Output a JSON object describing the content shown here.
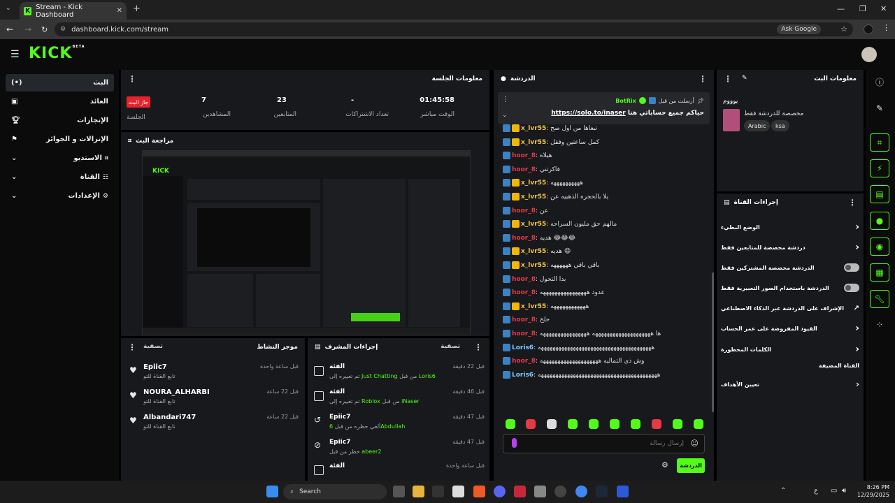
{
  "browser": {
    "tab_title": "Stream - Kick Dashboard",
    "url": "dashboard.kick.com/stream",
    "ask_google": "Ask Google"
  },
  "header": {
    "logo": "KICK",
    "logo_sup": "BETA"
  },
  "sidebar": {
    "items": [
      {
        "label": "البث",
        "icon": "broadcast-icon"
      },
      {
        "label": "العائد",
        "icon": "revenue-icon"
      },
      {
        "label": "الإنجازات",
        "icon": "trophy-icon"
      },
      {
        "label": "الإنزالات و الجوائز",
        "icon": "drops-icon"
      },
      {
        "label": "الاستديو",
        "icon": "studio-icon"
      },
      {
        "label": "القناة",
        "icon": "channel-icon"
      },
      {
        "label": "الإعدادات",
        "icon": "settings-icon"
      }
    ]
  },
  "session": {
    "title": "معلومات الجلسة",
    "live_badge": "جاز البث",
    "session_label": "الجلسة",
    "stats": [
      {
        "value": "01:45:58",
        "label": "الوقت مباشر"
      },
      {
        "value": "-",
        "label": "تعداد الاشتراكات"
      },
      {
        "value": "23",
        "label": "المتابعين"
      },
      {
        "value": "7",
        "label": "المشاهدين"
      }
    ]
  },
  "preview": {
    "title": "مراجعة البث"
  },
  "activity": {
    "title": "موجز النشاط",
    "filter": "تصفية",
    "items": [
      {
        "name": "Epiic7",
        "sub": "تابع القناة للتو",
        "time": "قبل ساعة واحدة"
      },
      {
        "name": "NOURA_ALHARBI",
        "sub": "تابع القناة للتو",
        "time": "قبل 22 ساعة"
      },
      {
        "name": "Albandari747",
        "sub": "تابع القناة للتو",
        "time": "قبل 22 ساعة"
      }
    ]
  },
  "modactions": {
    "title": "إجراءات المشرف",
    "filter": "تصفية",
    "items": [
      {
        "name": "الفئة",
        "sub_pre": "تم تغييره إلى",
        "hl1": "Just Chatting",
        "mid": "من قبل",
        "hl2": "Loris6",
        "time": "قبل 22 دقيقة"
      },
      {
        "name": "الفئة",
        "sub_pre": "تم تغييره إلى",
        "hl1": "Roblox",
        "mid": "من قبل",
        "hl2": "iNaser",
        "time": "قبل 46 دقيقة"
      },
      {
        "name": "Epiic7",
        "sub_pre": "ألغي حظره من قبل",
        "hl1": "",
        "mid": "",
        "hl2": "6Abdullah",
        "time": "قبل 47 دقيقة"
      },
      {
        "name": "Epiic7",
        "sub_pre": "حظر من قبل",
        "hl1": "",
        "mid": "",
        "hl2": "abeer2",
        "time": "قبل 47 دقيقة"
      },
      {
        "name": "الفئة",
        "sub_pre": "",
        "hl1": "",
        "mid": "",
        "hl2": "",
        "time": "قبل ساعة واحدة"
      }
    ]
  },
  "chat": {
    "title": "الدردشة",
    "pinned_by": "أرسلت من قبل",
    "pinned_user": "BotRix",
    "pinned_msg": "حياكم جميع حساباتي هنا",
    "pinned_link": "https://solo.to/inaser",
    "messages": [
      {
        "user": "x_lvr55",
        "cls": "u-x",
        "text": "تبغاها من اول صح"
      },
      {
        "user": "x_lvr55",
        "cls": "u-x",
        "text": "كمل ساعتين وفقل"
      },
      {
        "user": "hoor_8",
        "cls": "u-h",
        "text": "هيلاه"
      },
      {
        "user": "hoor_8",
        "cls": "u-h",
        "text": "فاكرتني"
      },
      {
        "user": "x_lvr55",
        "cls": "u-x",
        "text": "ههههههههههه"
      },
      {
        "user": "x_lvr55",
        "cls": "u-x",
        "text": "يلا بالحجره الذهبيه عن"
      },
      {
        "user": "hoor_8",
        "cls": "u-h",
        "text": "عن"
      },
      {
        "user": "x_lvr55",
        "cls": "u-x",
        "text": "مالهم حق مليون السراحه"
      },
      {
        "user": "hoor_8",
        "cls": "u-h",
        "text": "هديه 😂😂😂"
      },
      {
        "user": "x_lvr55",
        "cls": "u-x",
        "text": "هديه 😄"
      },
      {
        "user": "x_lvr55",
        "cls": "u-x",
        "text": "باقي باقي ههههههه"
      },
      {
        "user": "hoor_8",
        "cls": "u-h",
        "text": "بدا التحول"
      },
      {
        "user": "hoor_8",
        "cls": "u-h",
        "text": "عدود ههههههههههههههههه"
      },
      {
        "user": "x_lvr55",
        "cls": "u-x",
        "text": "ههههههههههههه"
      },
      {
        "user": "hoor_8",
        "cls": "u-h",
        "text": "حلح"
      },
      {
        "user": "hoor_8",
        "cls": "u-h",
        "text": "ها ههههههههههههههههههههه ههههههههههههههههه"
      },
      {
        "user": "Loris6",
        "cls": "u-l",
        "text": "هههههههههههههههههههههههههههههههههههههههه"
      },
      {
        "user": "hoor_8",
        "cls": "u-h",
        "text": "وش ذي التماليه ههههههههههههههههههههه"
      },
      {
        "user": "Loris6",
        "cls": "u-l",
        "text": "هههههههههههههههههههههههههههههههههههههههههه"
      }
    ],
    "input_placeholder": "إرسال رسالة",
    "send_button": "الدردشة"
  },
  "streaminfo": {
    "title": "معلومات البث",
    "stream_title": "يوووم",
    "category": "مخصصة للدردشة فقط",
    "tags": [
      "Arabic",
      "ksa"
    ]
  },
  "channelactions": {
    "title": "إجراءات القناة",
    "rows": [
      {
        "label": "الوضع البطيء",
        "control": "chevron"
      },
      {
        "label": "دردشة مخصصة للمتابعين فقط",
        "control": "chevron"
      },
      {
        "label": "الدردشة مخصصة المشتركين فقط",
        "control": "toggle"
      },
      {
        "label": "الدردشة باستخدام الصور التعبيرية فقط",
        "control": "toggle"
      },
      {
        "label": "الإشراف على الدردشة عبر الذكاء الاصطناعي",
        "control": "external"
      },
      {
        "label": "القيود المفروضة على عمر الحساب",
        "control": "chevron"
      },
      {
        "label": "الكلمات المحظورة",
        "control": "chevron"
      }
    ],
    "section": "القناة المضيفة",
    "goals": "تعيين الأهداف"
  },
  "taskbar": {
    "search": "Search",
    "lang": "ع",
    "time": "8:26 PM",
    "date": "12/29/2025"
  },
  "colors": {
    "accent": "#53fc18",
    "live": "#e6232d",
    "panel": "#18191c"
  }
}
